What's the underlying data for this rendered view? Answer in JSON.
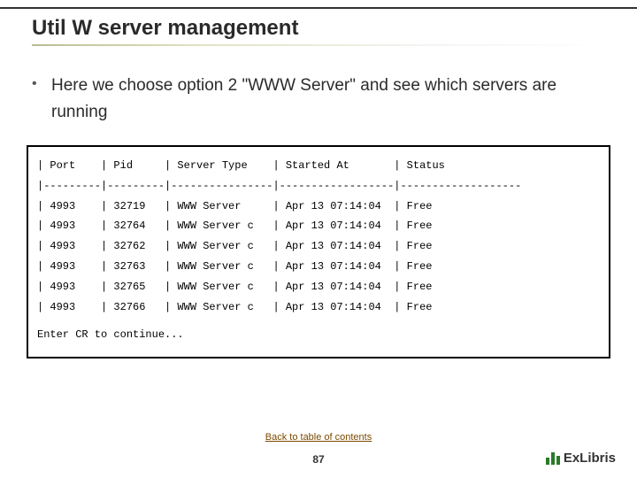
{
  "title": "Util W server management",
  "bullet": "Here we choose option 2 \"WWW Server\" and see which servers are running",
  "table": {
    "headers": {
      "port": "Port",
      "pid": "Pid",
      "server_type": "Server Type",
      "started_at": "Started At",
      "status": "Status"
    },
    "divider": "|---------|---------|----------------|------------------|-------------------",
    "rows": [
      {
        "port": "4993",
        "pid": "32719",
        "server_type": "WWW Server",
        "started_at": "Apr 13 07:14:04",
        "status": "Free"
      },
      {
        "port": "4993",
        "pid": "32764",
        "server_type": "WWW Server c",
        "started_at": "Apr 13 07:14:04",
        "status": "Free"
      },
      {
        "port": "4993",
        "pid": "32762",
        "server_type": "WWW Server c",
        "started_at": "Apr 13 07:14:04",
        "status": "Free"
      },
      {
        "port": "4993",
        "pid": "32763",
        "server_type": "WWW Server c",
        "started_at": "Apr 13 07:14:04",
        "status": "Free"
      },
      {
        "port": "4993",
        "pid": "32765",
        "server_type": "WWW Server c",
        "started_at": "Apr 13 07:14:04",
        "status": "Free"
      },
      {
        "port": "4993",
        "pid": "32766",
        "server_type": "WWW Server c",
        "started_at": "Apr 13 07:14:04",
        "status": "Free"
      }
    ],
    "continue_prompt": "Enter CR to continue..."
  },
  "footer": {
    "back_link": "Back to table of contents",
    "page_number": "87",
    "logo_text": "ExLibris"
  }
}
